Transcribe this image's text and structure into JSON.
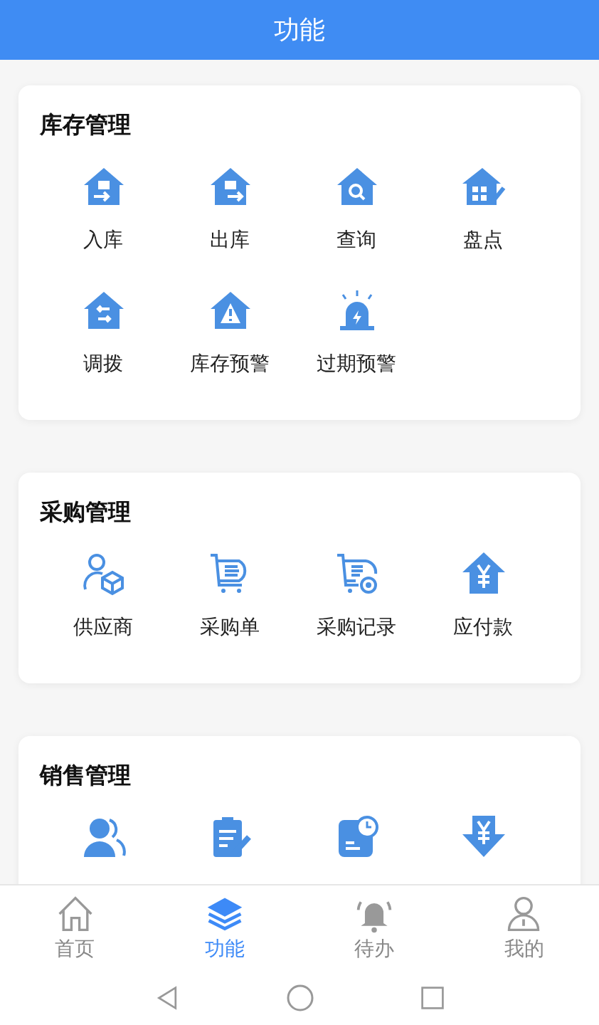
{
  "header": {
    "title": "功能"
  },
  "sections": [
    {
      "title": "库存管理",
      "items": [
        {
          "kind": "button",
          "label": "入库"
        },
        {
          "kind": "button",
          "label": "出库"
        },
        {
          "kind": "button",
          "label": "查询"
        },
        {
          "kind": "button",
          "label": "盘点"
        },
        {
          "kind": "button",
          "label": "调拨"
        },
        {
          "kind": "button",
          "label": "库存预警"
        },
        {
          "kind": "button",
          "label": "过期预警"
        }
      ]
    },
    {
      "title": "采购管理",
      "items": [
        {
          "kind": "button",
          "label": "供应商"
        },
        {
          "kind": "button",
          "label": "采购单"
        },
        {
          "kind": "button",
          "label": "采购记录"
        },
        {
          "kind": "button",
          "label": "应付款"
        }
      ]
    },
    {
      "title": "销售管理",
      "items": [
        {
          "kind": "icon"
        },
        {
          "kind": "icon"
        },
        {
          "kind": "icon"
        },
        {
          "kind": "icon"
        }
      ]
    }
  ],
  "tabs": [
    {
      "label": "首页",
      "selected": false
    },
    {
      "label": "功能",
      "selected": true
    },
    {
      "label": "待办",
      "selected": false
    },
    {
      "label": "我的",
      "selected": false
    }
  ]
}
